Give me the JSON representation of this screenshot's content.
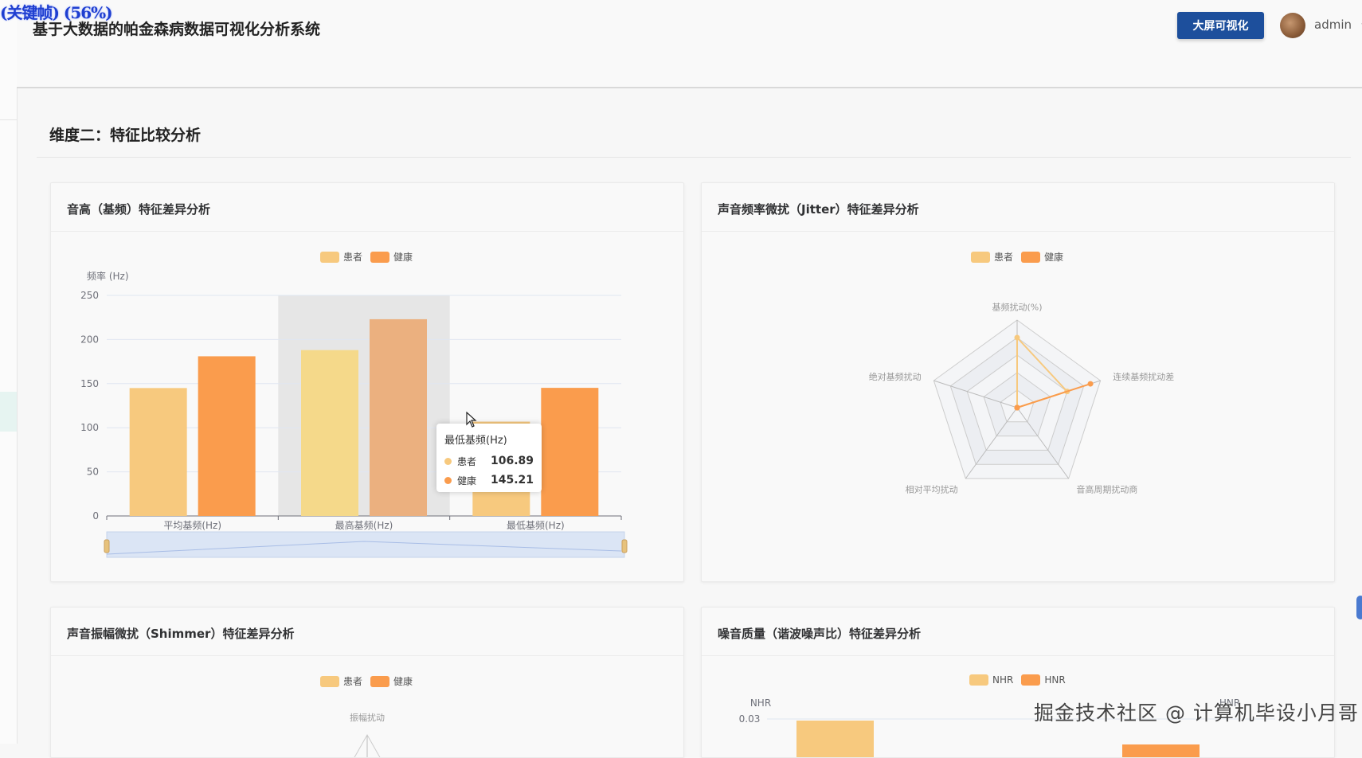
{
  "overlay": {
    "label": "(关键帧) (56%)"
  },
  "header": {
    "title": "基于大数据的帕金森病数据可视化分析系统",
    "big_screen_button": "大屏可视化",
    "username": "admin",
    "caret": "⌵"
  },
  "section": {
    "title": "维度二：特征比较分析"
  },
  "cards": {
    "pitch": {
      "title": "音高（基频）特征差异分析"
    },
    "jitter": {
      "title": "声音频率微扰（Jitter）特征差异分析"
    },
    "shimmer": {
      "title": "声音振幅微扰（Shimmer）特征差异分析"
    },
    "noise": {
      "title": "噪音质量（谐波噪声比）特征差异分析"
    }
  },
  "chart_data": [
    {
      "id": "pitch",
      "type": "bar",
      "ylabel": "频率 (Hz)",
      "ylim": [
        0,
        250
      ],
      "yticks": [
        0,
        50,
        100,
        150,
        200,
        250
      ],
      "categories": [
        "平均基频(Hz)",
        "最高基频(Hz)",
        "最低基频(Hz)"
      ],
      "series": [
        {
          "name": "患者",
          "values": [
            145,
            188,
            106.89
          ],
          "color": "#f7c97e"
        },
        {
          "name": "健康",
          "values": [
            181,
            223,
            145.21
          ],
          "color": "#fa9c4d"
        }
      ],
      "legend_position": "top-center",
      "grid": true,
      "highlighted_category": "最高基频(Hz)",
      "tooltip": {
        "title": "最低基频(Hz)",
        "rows": [
          {
            "name": "患者",
            "value": "106.89",
            "color": "#f7c97e"
          },
          {
            "name": "健康",
            "value": "145.21",
            "color": "#fa9c4d"
          }
        ]
      },
      "datazoom": true
    },
    {
      "id": "jitter",
      "type": "radar",
      "indicators": [
        "基频扰动(%)",
        "连续基频扰动差",
        "音高周期扰动商",
        "相对平均扰动",
        "绝对基频扰动"
      ],
      "series": [
        {
          "name": "患者",
          "values": [
            0.8,
            0.6,
            0,
            0,
            0
          ],
          "color": "#f7c97e"
        },
        {
          "name": "健康",
          "values": [
            0,
            0.88,
            0,
            0,
            0
          ],
          "color": "#fa9c4d"
        }
      ],
      "legend_position": "top-center"
    },
    {
      "id": "shimmer",
      "type": "radar",
      "indicators": [
        "振幅扰动"
      ],
      "series": [
        {
          "name": "患者",
          "color": "#f7c97e"
        },
        {
          "name": "健康",
          "color": "#fa9c4d"
        }
      ],
      "legend_position": "top-center"
    },
    {
      "id": "noise",
      "type": "bar",
      "ylabel": "NHR",
      "yticks_visible": [
        "0.03"
      ],
      "right_axis_label": "HNR",
      "series": [
        {
          "name": "NHR",
          "color": "#f7c97e"
        },
        {
          "name": "HNR",
          "color": "#fa9c4d"
        }
      ],
      "legend_position": "top-center"
    }
  ],
  "legend": {
    "patient": "患者",
    "healthy": "健康",
    "nhr": "NHR",
    "hnr": "HNR",
    "patient_color": "#f7c97e",
    "healthy_color": "#fa9c4d"
  },
  "watermark": "掘金技术社区 @ 计算机毕设小月哥"
}
